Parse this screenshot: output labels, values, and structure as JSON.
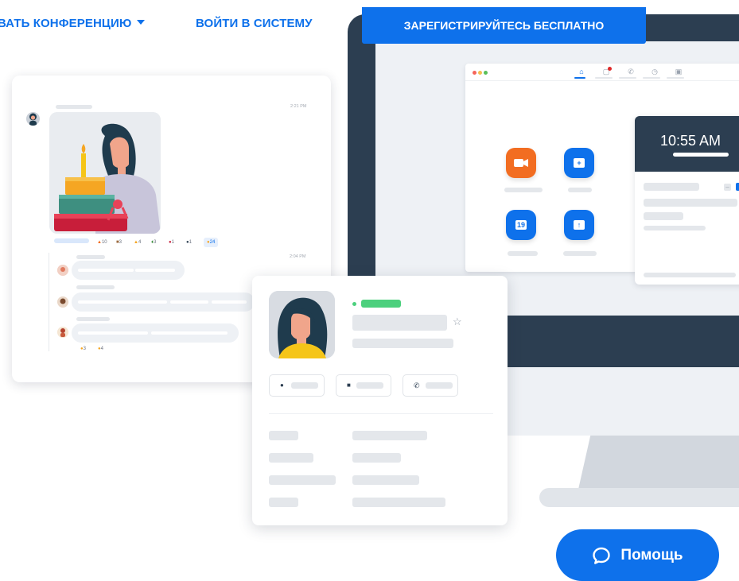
{
  "header": {
    "host_meeting_label": "ВАТЬ КОНФЕРЕНЦИЮ",
    "sign_in_label": "ВОЙТИ В СИСТЕМУ",
    "sign_up_label": "ЗАРЕГИСТРИРУЙТЕСЬ БЕСПЛАТНО"
  },
  "chat": {
    "first_time": "2:21 PM",
    "second_time": "2:04 PM",
    "reactions": [
      {
        "icon": "fire-icon",
        "count": "10"
      },
      {
        "icon": "gift-icon",
        "count": "3"
      },
      {
        "icon": "cake-icon",
        "count": "4"
      },
      {
        "icon": "party-icon",
        "count": "3"
      },
      {
        "icon": "hand-icon",
        "count": "1"
      },
      {
        "icon": "cool-icon",
        "count": "1"
      },
      {
        "icon": "thumbs-icon",
        "count": "24"
      }
    ],
    "thread_reactions": [
      {
        "icon": "smile-icon",
        "count": "3"
      },
      {
        "icon": "sunglasses-icon",
        "count": "4"
      }
    ]
  },
  "desktop_app": {
    "clock_time": "10:55 AM"
  },
  "help": {
    "label": "Помощь"
  },
  "colors": {
    "brand_blue": "#0E71EB",
    "dark_navy": "#2C3E51",
    "orange": "#F26D21",
    "status_green": "#4CD07D"
  }
}
